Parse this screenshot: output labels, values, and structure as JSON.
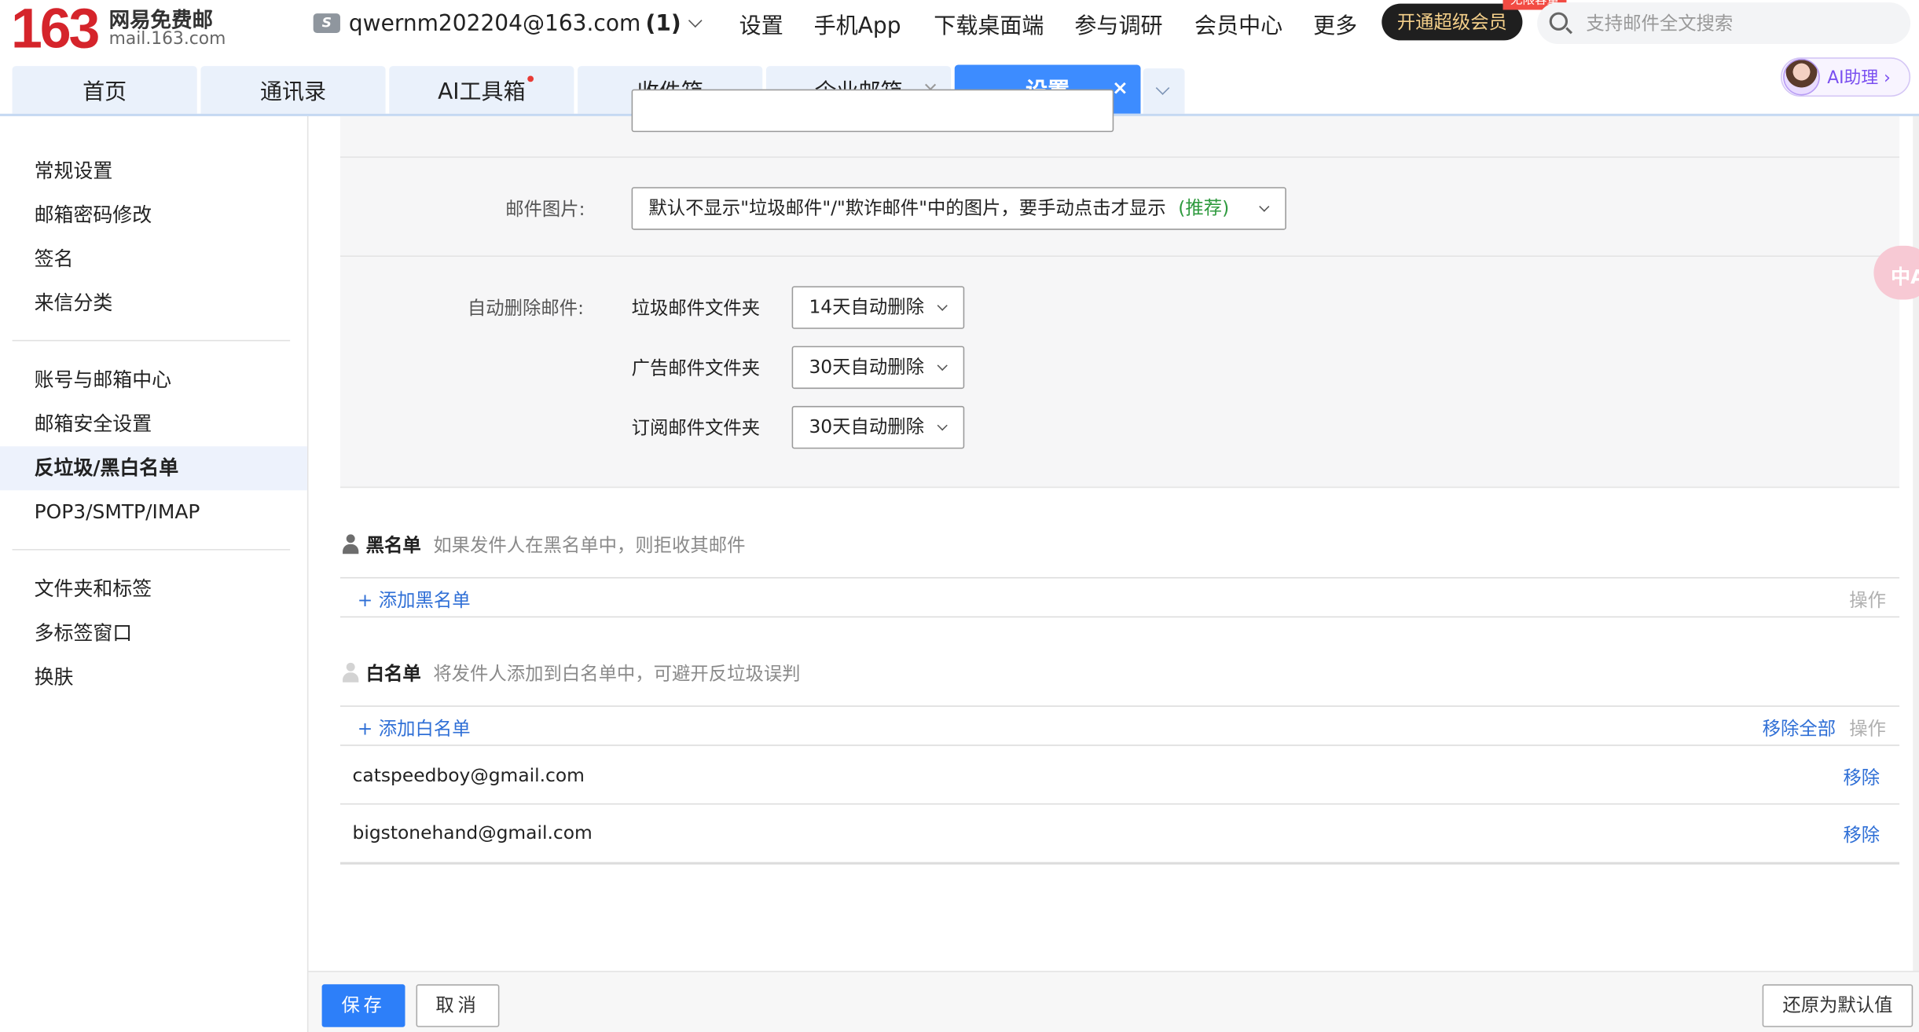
{
  "brand": {
    "number": "163",
    "name_cn": "网易免费邮",
    "domain": "mail.163.com"
  },
  "account": {
    "badge": "S",
    "email": "qwernm202204@163.com",
    "count": "(1)"
  },
  "topnav": [
    {
      "label": "设置"
    },
    {
      "label": "手机App"
    },
    {
      "label": "下载桌面端"
    },
    {
      "label": "参与调研"
    },
    {
      "label": "会员中心"
    },
    {
      "label": "更多"
    }
  ],
  "vip": {
    "label": "开通超级会员",
    "tag": "无限容量"
  },
  "search": {
    "placeholder": "支持邮件全文搜索"
  },
  "tabs": [
    {
      "label": "首页"
    },
    {
      "label": "通讯录"
    },
    {
      "label": "AI工具箱"
    },
    {
      "label": "收件箱"
    },
    {
      "label": "企业邮箱",
      "close": "×"
    },
    {
      "label": "设置",
      "close": "×"
    }
  ],
  "ai_helper": {
    "label": "AI助理 ›"
  },
  "sidebar": {
    "items": [
      {
        "label": "常规设置"
      },
      {
        "label": "邮箱密码修改"
      },
      {
        "label": "签名"
      },
      {
        "label": "来信分类"
      },
      {
        "label": "账号与邮箱中心"
      },
      {
        "label": "邮箱安全设置"
      },
      {
        "label": "反垃圾/黑白名单"
      },
      {
        "label": "POP3/SMTP/IMAP"
      },
      {
        "label": "文件夹和标签"
      },
      {
        "label": "多标签窗口"
      },
      {
        "label": "换肤"
      }
    ]
  },
  "settings": {
    "image_label": "邮件图片:",
    "image_value": "默认不显示\"垃圾邮件\"/\"欺诈邮件\"中的图片，要手动点击才显示",
    "image_recommend": "(推荐)",
    "auto_delete_label": "自动删除邮件:",
    "auto_delete": [
      {
        "folder": "垃圾邮件文件夹",
        "value": "14天自动删除"
      },
      {
        "folder": "广告邮件文件夹",
        "value": "30天自动删除"
      },
      {
        "folder": "订阅邮件文件夹",
        "value": "30天自动删除"
      }
    ]
  },
  "blacklist": {
    "title": "黑名单",
    "desc": "如果发件人在黑名单中，则拒收其邮件",
    "add": "+ 添加黑名单",
    "op": "操作"
  },
  "whitelist": {
    "title": "白名单",
    "desc": "将发件人添加到白名单中，可避开反垃圾误判",
    "add": "+ 添加白名单",
    "remove_all": "移除全部",
    "op": "操作",
    "entries": [
      {
        "email": "catspeedboy@gmail.com",
        "action": "移除"
      },
      {
        "email": "bigstonehand@gmail.com",
        "action": "移除"
      }
    ]
  },
  "footer": {
    "save": "保存",
    "cancel": "取消",
    "restore": "还原为默认值"
  },
  "float_translate": {
    "glyph": "中A"
  },
  "colors": {
    "brand_red": "#d5242b",
    "tab_active": "#3d8cff",
    "link": "#2f6fd6",
    "recommend": "#2e9a3e"
  }
}
